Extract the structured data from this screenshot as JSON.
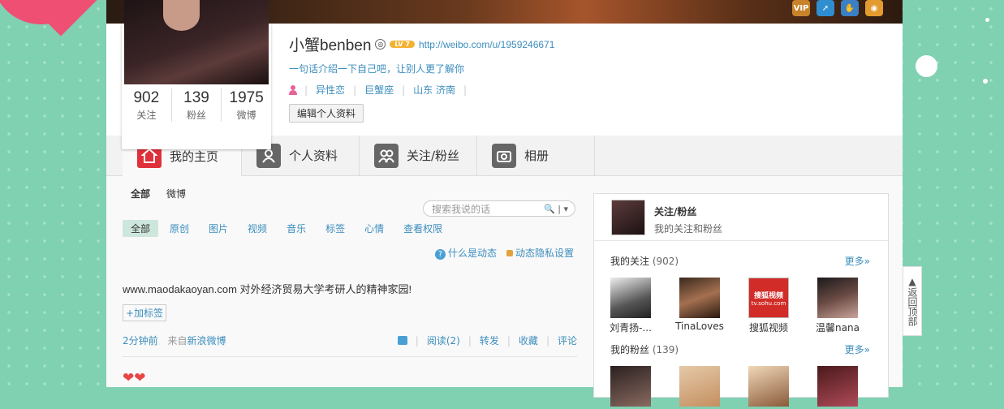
{
  "colors": {
    "accent": "#3b8dbd",
    "background": "#7fd1b2",
    "home_icon": "#e0303a"
  },
  "cover": {
    "icons": [
      "vip-icon",
      "arrow-icon",
      "hand-icon",
      "badge-icon"
    ],
    "vip_text": "VIP"
  },
  "profile": {
    "name": "小蟹benben",
    "level": "LV 7",
    "url": "http://weibo.com/u/1959246671",
    "bio": "一句话介绍一下自己吧，让别人更了解你",
    "tags": [
      "异性恋",
      "巨蟹座",
      "山东 济南"
    ],
    "edit_label": "编辑个人资料",
    "stats": [
      {
        "num": "902",
        "label": "关注"
      },
      {
        "num": "139",
        "label": "粉丝"
      },
      {
        "num": "1975",
        "label": "微博"
      }
    ]
  },
  "tabs": [
    "我的主页",
    "个人资料",
    "关注/粉丝",
    "相册"
  ],
  "feed": {
    "top_tabs": [
      "全部",
      "微博"
    ],
    "search_placeholder": "搜索我说的话",
    "filters": [
      "全部",
      "原创",
      "图片",
      "视频",
      "音乐",
      "标签",
      "心情",
      "查看权限"
    ],
    "what_is": "什么是动态",
    "privacy": "动态隐私设置",
    "post": {
      "text": "www.maodakaoyan.com 对外经济贸易大学考研人的精神家园!",
      "add_tag": "+加标签",
      "time": "2分钟前",
      "from_prefix": "来自",
      "source": "新浪微博",
      "read": "阅读(2)",
      "repost": "转发",
      "fav": "收藏",
      "comment": "评论"
    }
  },
  "sidebar": {
    "title": "关注/粉丝",
    "subtitle": "我的关注和粉丝",
    "following_title": "我的关注",
    "following_count": "(902)",
    "more": "更多»",
    "following": [
      {
        "name": "刘青扬-..."
      },
      {
        "name": "TinaLoves"
      },
      {
        "name": "搜狐视频"
      },
      {
        "name": "温馨nana"
      }
    ],
    "fans_title": "我的粉丝",
    "fans_count": "(139)",
    "sohu_logo": "搜狐视频",
    "sohu_url": "tv.sohu.com"
  },
  "back_to_top": "返回顶部"
}
